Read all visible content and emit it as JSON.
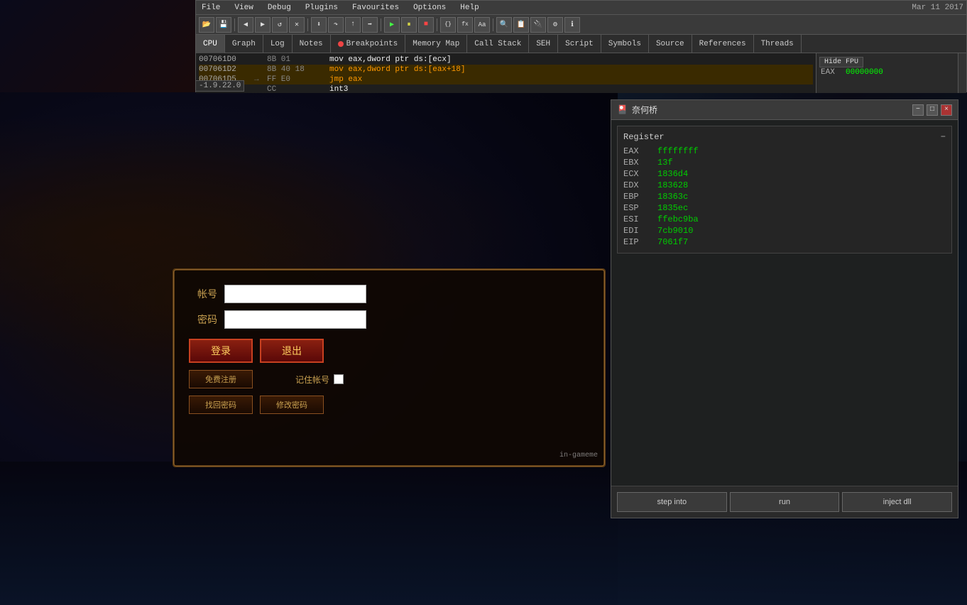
{
  "menu": {
    "items": [
      "File",
      "View",
      "Debug",
      "Plugins",
      "Favourites",
      "Options",
      "Help"
    ],
    "date": "Mar 11 2017"
  },
  "tabs": [
    {
      "label": "CPU",
      "icon": "cpu",
      "active": true,
      "dot": false
    },
    {
      "label": "Graph",
      "icon": "graph",
      "active": false,
      "dot": false
    },
    {
      "label": "Log",
      "icon": "log",
      "active": false,
      "dot": false
    },
    {
      "label": "Notes",
      "icon": "notes",
      "active": false,
      "dot": false
    },
    {
      "label": "Breakpoints",
      "icon": "breakpoints",
      "active": false,
      "dot": true
    },
    {
      "label": "Memory Map",
      "icon": "memory",
      "active": false,
      "dot": false
    },
    {
      "label": "Call Stack",
      "icon": "callstack",
      "active": false,
      "dot": false
    },
    {
      "label": "SEH",
      "icon": "seh",
      "active": false,
      "dot": false
    },
    {
      "label": "Script",
      "icon": "script",
      "active": false,
      "dot": false
    },
    {
      "label": "Symbols",
      "icon": "symbols",
      "active": false,
      "dot": false
    },
    {
      "label": "Source",
      "icon": "source",
      "active": false,
      "dot": false
    },
    {
      "label": "References",
      "icon": "references",
      "active": false,
      "dot": false
    },
    {
      "label": "Threads",
      "icon": "threads",
      "active": false,
      "dot": false
    }
  ],
  "disasm": {
    "rows": [
      {
        "addr": "007061D0",
        "arrow": "",
        "bytes": "8B 01",
        "instr": "mov eax,dword ptr ds:[ecx]",
        "highlight": false
      },
      {
        "addr": "007061D2",
        "arrow": "",
        "bytes": "8B 40 18",
        "instr": "mov eax,dword ptr ds:[eax+18]",
        "highlight": true
      },
      {
        "addr": "007061D5",
        "arrow": "→",
        "bytes": "FF E0",
        "instr": "jmp eax",
        "highlight": true
      },
      {
        "addr": "007061D7",
        "arrow": "",
        "bytes": "CC",
        "instr": "int3",
        "highlight": false
      }
    ]
  },
  "registers_top": {
    "hide_fpu_label": "Hide FPU",
    "eax_label": "EAX",
    "eax_value": "00000000"
  },
  "version": "-1.9.22.0",
  "dialog": {
    "title": "奈何桥",
    "title_icon": "🎴",
    "minimize_label": "−",
    "maximize_label": "□",
    "close_label": "×",
    "register_section": {
      "header": "Register",
      "minus": "−",
      "registers": [
        {
          "name": "EAX",
          "value": "ffffffff"
        },
        {
          "name": "EBX",
          "value": "13f"
        },
        {
          "name": "ECX",
          "value": "1836d4"
        },
        {
          "name": "EDX",
          "value": "183628"
        },
        {
          "name": "EBP",
          "value": "18363c"
        },
        {
          "name": "ESP",
          "value": "1835ec"
        },
        {
          "name": "ESI",
          "value": "ffebc9ba"
        },
        {
          "name": "EDI",
          "value": "7cb9010"
        },
        {
          "name": "EIP",
          "value": "7061f7"
        }
      ]
    },
    "buttons": [
      {
        "label": "step into",
        "id": "step-into"
      },
      {
        "label": "run",
        "id": "run"
      },
      {
        "label": "inject dll",
        "id": "inject-dll"
      }
    ]
  },
  "game_login": {
    "account_label": "帐号",
    "password_label": "密码",
    "login_btn": "登录",
    "exit_btn": "退出",
    "register_btn": "免费注册",
    "remember_label": "记住帐号",
    "find_pwd_btn": "找回密码",
    "change_pwd_btn": "修改密码",
    "watermark": "in-gameme"
  }
}
